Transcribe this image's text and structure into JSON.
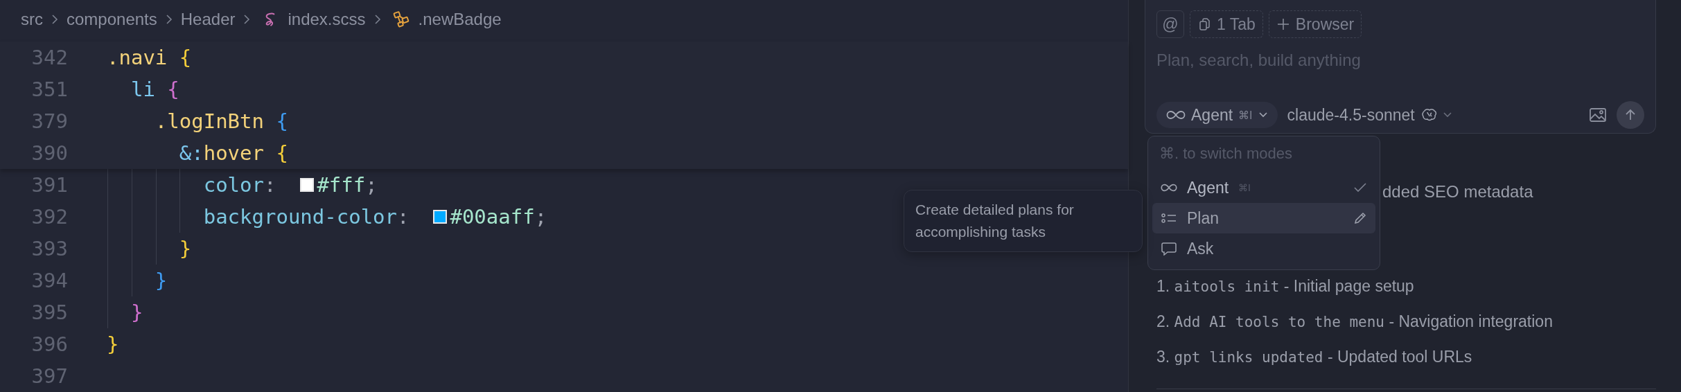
{
  "breadcrumb": [
    {
      "label": "src",
      "kind": "folder"
    },
    {
      "label": "components",
      "kind": "folder"
    },
    {
      "label": "Header",
      "kind": "folder"
    },
    {
      "label": "index.scss",
      "kind": "file"
    },
    {
      "label": ".newBadge",
      "kind": "symbol"
    }
  ],
  "editor": {
    "sticky_lines": [
      {
        "number": "342",
        "tokens": [
          {
            "kind": "selector",
            "text": ".navi "
          },
          {
            "kind": "bracket1",
            "text": "{"
          }
        ]
      },
      {
        "number": "351",
        "tokens": [
          {
            "kind": "tag",
            "text": "  li "
          },
          {
            "kind": "bracket2",
            "text": "{"
          }
        ]
      },
      {
        "number": "379",
        "tokens": [
          {
            "kind": "selector",
            "text": "    .logInBtn "
          },
          {
            "kind": "bracket3",
            "text": "{"
          }
        ]
      },
      {
        "number": "390",
        "tokens": [
          {
            "kind": "tag",
            "text": "      &:"
          },
          {
            "kind": "selector",
            "text": "hover "
          },
          {
            "kind": "bracket1",
            "text": "{"
          }
        ]
      }
    ],
    "lines": [
      {
        "number": "391",
        "tokens": [
          {
            "kind": "property",
            "text": "        color"
          },
          {
            "kind": "punct",
            "text": ":  "
          },
          {
            "kind": "swatch",
            "color": "#ffffff"
          },
          {
            "kind": "value",
            "text": "#fff"
          },
          {
            "kind": "punct",
            "text": ";"
          }
        ]
      },
      {
        "number": "392",
        "tokens": [
          {
            "kind": "property",
            "text": "        background-color"
          },
          {
            "kind": "punct",
            "text": ":  "
          },
          {
            "kind": "swatch",
            "color": "#00aaff"
          },
          {
            "kind": "value",
            "text": "#00aaff"
          },
          {
            "kind": "punct",
            "text": ";"
          }
        ]
      },
      {
        "number": "393",
        "tokens": [
          {
            "kind": "bracket1",
            "text": "      }"
          }
        ]
      },
      {
        "number": "394",
        "tokens": [
          {
            "kind": "bracket3",
            "text": "    }"
          }
        ]
      },
      {
        "number": "395",
        "tokens": [
          {
            "kind": "bracket2",
            "text": "  }"
          }
        ]
      },
      {
        "number": "396",
        "tokens": [
          {
            "kind": "bracket1",
            "text": "}"
          }
        ]
      },
      {
        "number": "397"
      }
    ]
  },
  "tooltip": {
    "text": "Create detailed plans for accomplishing tasks"
  },
  "composer": {
    "chips": [
      {
        "kind": "mention",
        "label": "@"
      },
      {
        "kind": "tab",
        "label": "1 Tab"
      },
      {
        "kind": "add",
        "label": "Browser"
      }
    ],
    "placeholder": "Plan, search, build anything",
    "mode": {
      "label": "Agent",
      "shortcut": "⌘I"
    },
    "model": "claude-4.5-sonnet"
  },
  "mode_menu": {
    "hint": "⌘. to switch modes",
    "items": [
      {
        "label": "Agent",
        "shortcut": "⌘I",
        "selected": true,
        "hovered": false
      },
      {
        "label": "Plan",
        "selected": false,
        "hovered": true
      },
      {
        "label": "Ask",
        "selected": false,
        "hovered": false
      }
    ]
  },
  "chat": {
    "fragment": "dded SEO metadata",
    "items": [
      {
        "number": "1.",
        "code": "aitools init",
        "text": " - Initial page setup"
      },
      {
        "number": "2.",
        "code": "Add AI tools to the menu",
        "text": " - Navigation integration"
      },
      {
        "number": "3.",
        "code": "gpt links updated",
        "text": " - Updated tool URLs"
      }
    ]
  }
}
